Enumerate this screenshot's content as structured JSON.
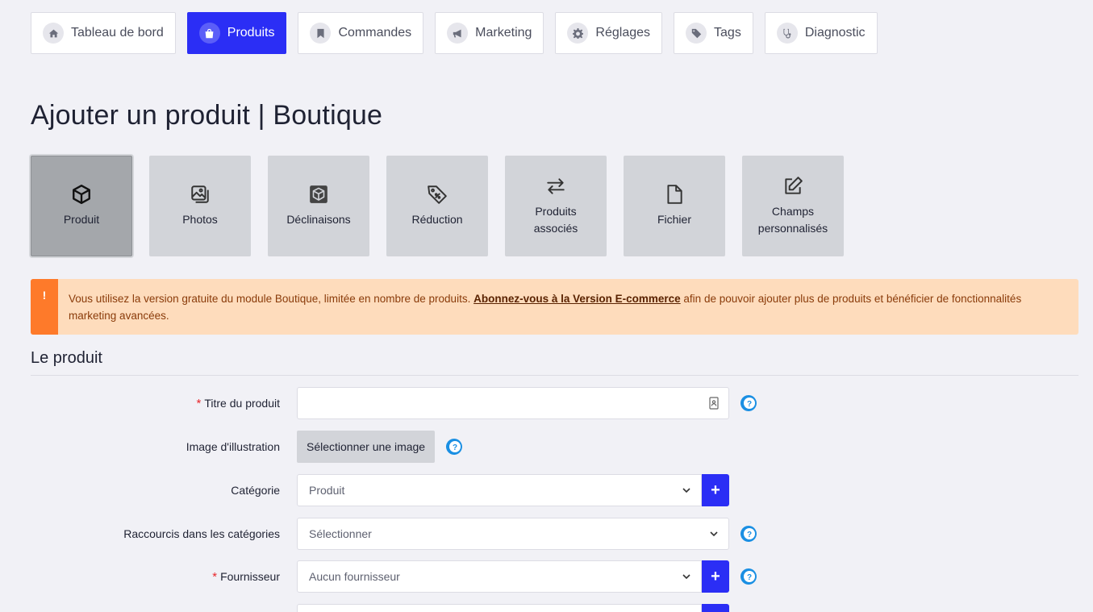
{
  "nav": [
    {
      "label": "Tableau de bord",
      "icon": "home-icon",
      "active": false
    },
    {
      "label": "Produits",
      "icon": "shopping-bag-icon",
      "active": true
    },
    {
      "label": "Commandes",
      "icon": "bookmark-icon",
      "active": false
    },
    {
      "label": "Marketing",
      "icon": "megaphone-icon",
      "active": false
    },
    {
      "label": "Réglages",
      "icon": "gear-icon",
      "active": false
    },
    {
      "label": "Tags",
      "icon": "tags-icon",
      "active": false
    },
    {
      "label": "Diagnostic",
      "icon": "stethoscope-icon",
      "active": false
    }
  ],
  "page_title": "Ajouter un produit | Boutique",
  "tiles": [
    {
      "label": "Produit",
      "icon": "cube-icon"
    },
    {
      "label": "Photos",
      "icon": "photos-icon"
    },
    {
      "label": "Déclinaisons",
      "icon": "box-variant-icon"
    },
    {
      "label": "Réduction",
      "icon": "discount-tag-icon"
    },
    {
      "label": "Produits associés",
      "icon": "swap-arrows-icon"
    },
    {
      "label": "Fichier",
      "icon": "file-icon"
    },
    {
      "label": "Champs personnalisés",
      "icon": "edit-square-icon"
    }
  ],
  "alert": {
    "mark": "!",
    "text_before": "Vous utilisez la version gratuite du module Boutique, limitée en nombre de produits. ",
    "link": "Abonnez-vous à la Version E-commerce",
    "text_after": " afin de pouvoir ajouter plus de produits et bénéficier de fonctionnalités marketing avancées.",
    "color": "#fedcbc",
    "accent": "#fe7a2a"
  },
  "section_title": "Le produit",
  "form": {
    "title_label": "Titre du produit",
    "title_value": "",
    "image_label": "Image d'illustration",
    "image_button": "Sélectionner une image",
    "category_label": "Catégorie",
    "category_value": "Produit",
    "shortcuts_label": "Raccourcis dans les catégories",
    "shortcuts_value": "Sélectionner",
    "supplier_label": "Fournisseur",
    "supplier_value": "Aucun fournisseur",
    "required_mark": "*",
    "plus": "+"
  },
  "colors": {
    "primary": "#2b2ef5",
    "help": "#1a8fe3"
  }
}
